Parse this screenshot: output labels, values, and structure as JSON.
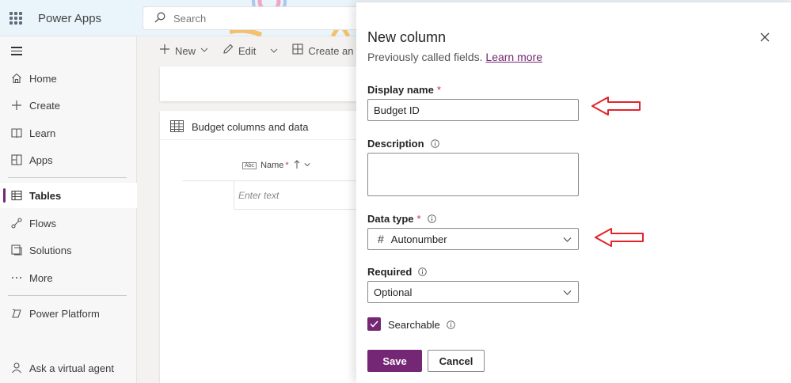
{
  "app": {
    "title": "Power Apps"
  },
  "search": {
    "placeholder": "Search"
  },
  "nav": {
    "items": [
      {
        "label": "Home",
        "icon": "home-icon"
      },
      {
        "label": "Create",
        "icon": "plus-icon"
      },
      {
        "label": "Learn",
        "icon": "book-icon"
      },
      {
        "label": "Apps",
        "icon": "apps-icon"
      },
      {
        "label": "Tables",
        "icon": "table-icon",
        "active": true
      },
      {
        "label": "Flows",
        "icon": "flow-icon"
      },
      {
        "label": "Solutions",
        "icon": "solutions-icon"
      },
      {
        "label": "More",
        "icon": "more-icon"
      },
      {
        "label": "Power Platform",
        "icon": "power-platform-icon"
      },
      {
        "label": "Ask a virtual agent",
        "icon": "bot-icon"
      }
    ]
  },
  "commandbar": {
    "new_label": "New",
    "edit_label": "Edit",
    "create_label": "Create an app"
  },
  "table": {
    "title": "Budget columns and data",
    "column_name": "Name",
    "required_mark": "*",
    "cell_placeholder": "Enter text"
  },
  "panel": {
    "title": "New column",
    "subtitle": "Previously called fields.",
    "learn_more": "Learn more",
    "display_name_label": "Display name",
    "display_name_value": "Budget ID",
    "required_mark": "*",
    "description_label": "Description",
    "description_value": "",
    "data_type_label": "Data type",
    "data_type_value": "Autonumber",
    "data_type_icon": "#",
    "required_label": "Required",
    "required_value": "Optional",
    "searchable_label": "Searchable",
    "searchable_checked": true,
    "save_label": "Save",
    "cancel_label": "Cancel"
  },
  "colors": {
    "brand": "#742774",
    "arrow": "#e3242b",
    "topbar": "#eaf4fb"
  }
}
